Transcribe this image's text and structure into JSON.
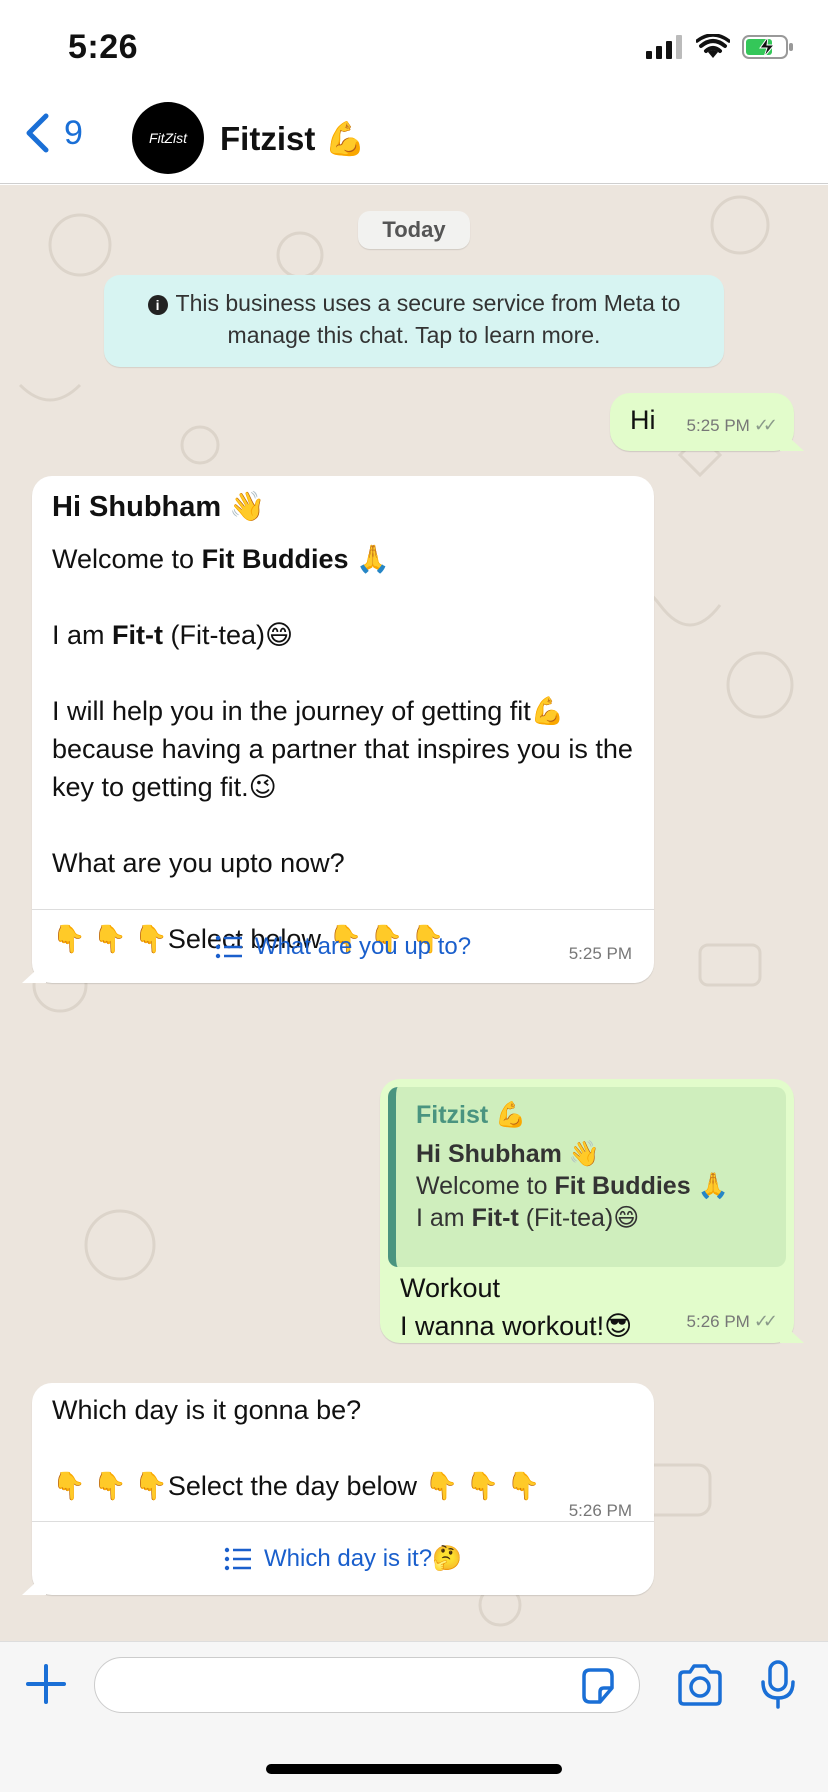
{
  "status_bar": {
    "time": "5:26",
    "signal_icon": "cellular-signal-icon",
    "wifi_icon": "wifi-icon",
    "battery_icon": "battery-charging-icon"
  },
  "header": {
    "back_count": "9",
    "avatar_text": "FitZist",
    "contact_name": "Fitzist 💪"
  },
  "chat": {
    "date_label": "Today",
    "notice": "This business uses a secure service from Meta to manage this chat. Tap to learn more.",
    "messages": {
      "m1": {
        "text": "Hi",
        "time": "5:25 PM"
      },
      "m2": {
        "title": "Hi Shubham 👋",
        "welcome_pre": "Welcome to ",
        "welcome_bold": "Fit Buddies",
        "welcome_post": " 🙏",
        "iam_pre": "I am ",
        "iam_bold": "Fit-t",
        "iam_post": " (Fit-tea)😄",
        "help": "I will help you in the journey of getting fit💪 because having a partner that inspires you is the key to getting fit.😉",
        "question": "What are you upto now?",
        "select": "👇 👇 👇Select below  👇 👇 👇",
        "time": "5:25 PM",
        "button": "What are you up to?"
      },
      "m3": {
        "quote_author": "Fitzist 💪",
        "quote_line1": "Hi Shubham 👋",
        "quote_line2_pre": "Welcome to ",
        "quote_line2_bold": "Fit Buddies",
        "quote_line2_post": " 🙏",
        "quote_line3_pre": "I am ",
        "quote_line3_bold": "Fit-t",
        "quote_line3_post": " (Fit-tea)😄",
        "line1": "Workout",
        "line2": "I wanna workout!😎",
        "time": "5:26 PM"
      },
      "m4": {
        "text": "Which day is it gonna be?",
        "select": "👇 👇 👇Select the day below 👇 👇 👇",
        "time": "5:26 PM",
        "button": "Which day is it?🤔"
      }
    }
  },
  "input_bar": {
    "placeholder": ""
  },
  "colors": {
    "accent": "#1a6fd6",
    "outgoing_bubble": "#e2fccb",
    "incoming_bubble": "#ffffff",
    "chat_background": "#ece5dd",
    "notice_background": "#d7f4f2"
  }
}
